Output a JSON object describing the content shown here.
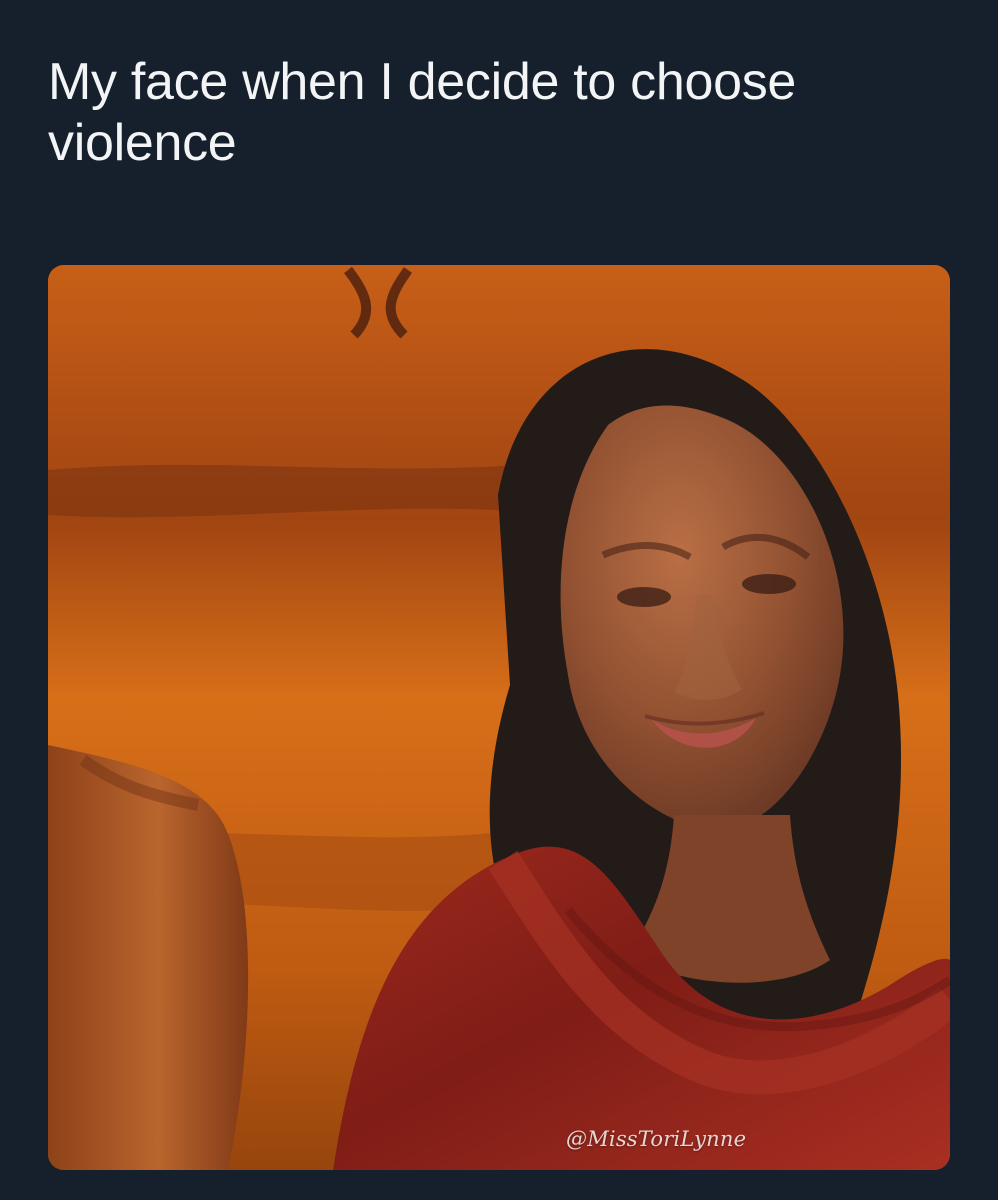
{
  "post": {
    "caption": "My face when I decide to choose violence",
    "media": {
      "subject": "woman-smirking-photo",
      "watermark": "@MissToriLynne"
    }
  },
  "colors": {
    "background": "#16202c",
    "caption_text": "#f3f4f6",
    "photo_backdrop": "#b9530f",
    "red_sweater": "#8b1d14"
  }
}
